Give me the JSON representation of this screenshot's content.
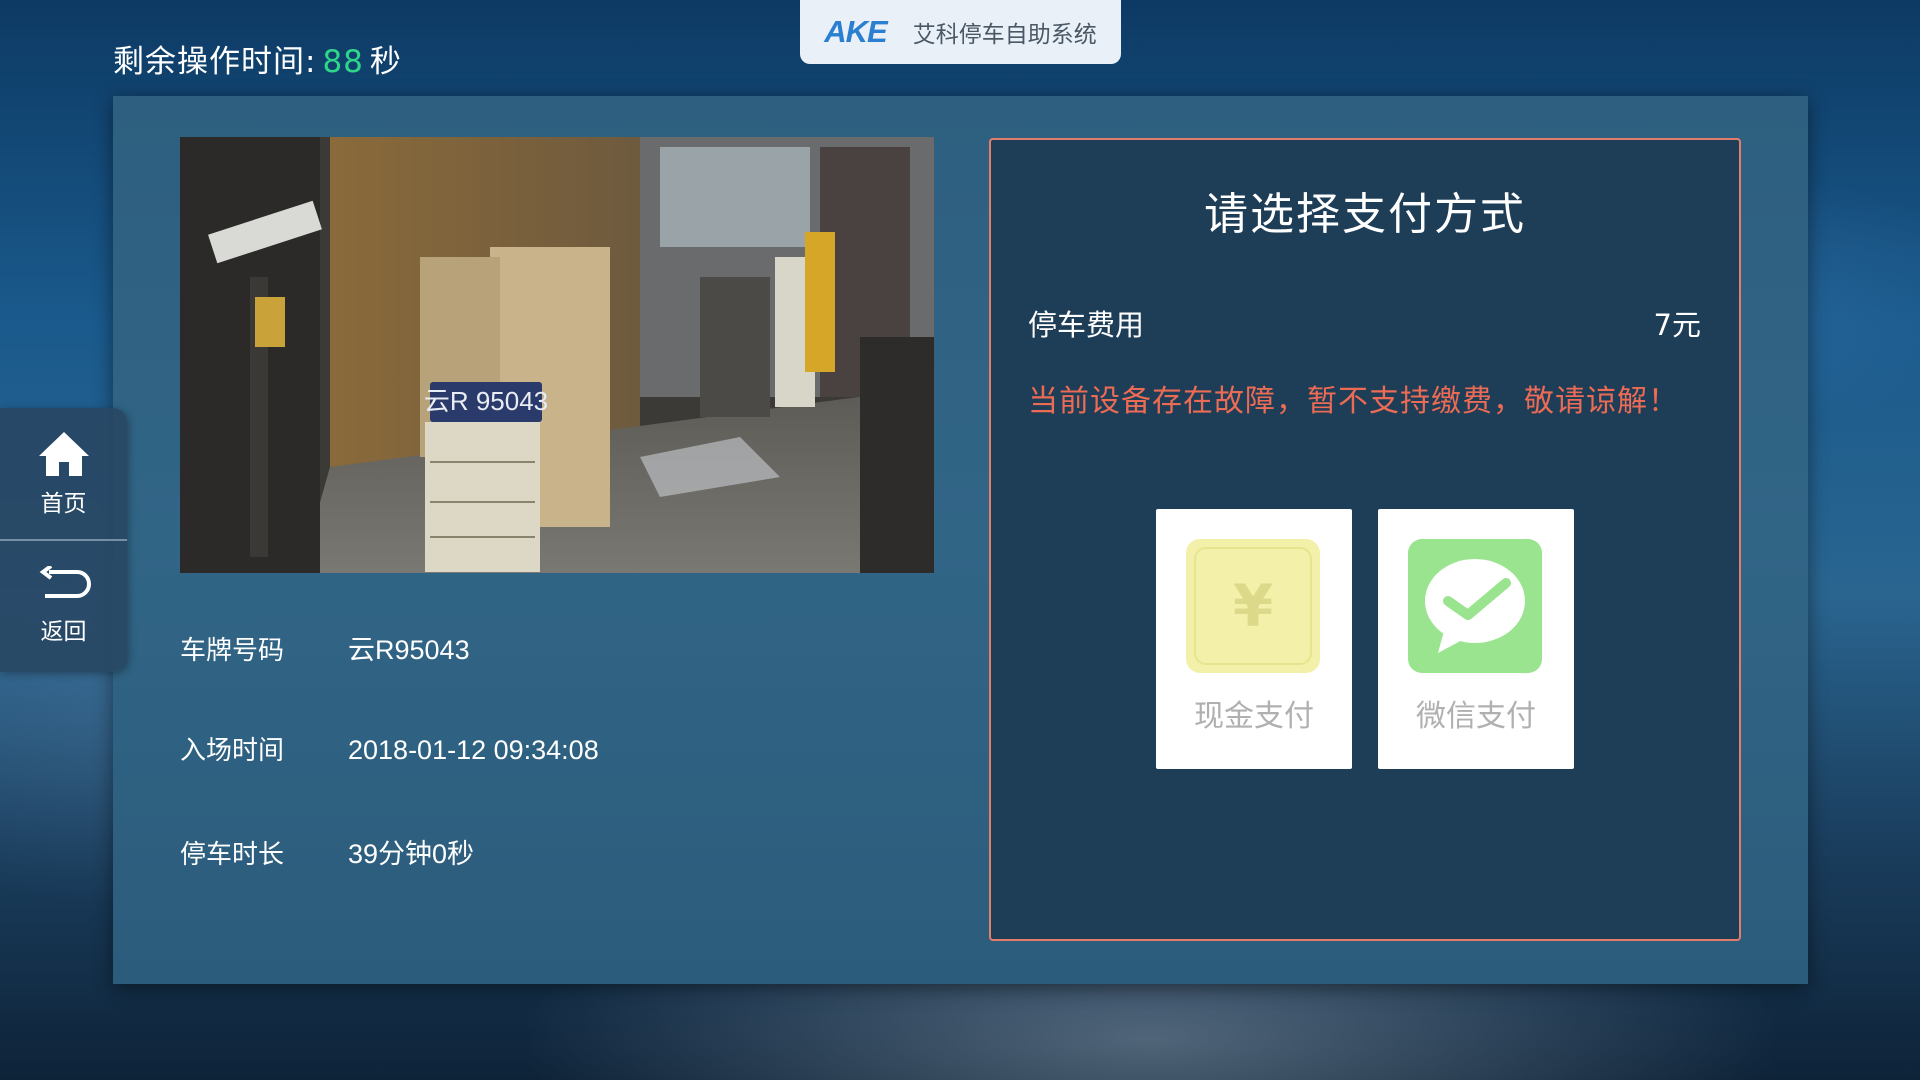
{
  "header": {
    "timer_label": "剩余操作时间:",
    "timer_value": "88",
    "timer_unit": "秒",
    "brand": "AKE",
    "system_name": "艾科停车自助系统"
  },
  "sidebar": {
    "items": [
      {
        "label": "首页",
        "icon": "home-icon"
      },
      {
        "label": "返回",
        "icon": "back-arrow-icon"
      }
    ]
  },
  "camera": {
    "plate_overlay": "云R 95043"
  },
  "vehicle": {
    "rows": [
      {
        "label": "车牌号码",
        "value": "云R95043"
      },
      {
        "label": "入场时间",
        "value": "2018-01-12 09:34:08"
      },
      {
        "label": "停车时长",
        "value": "39分钟0秒"
      }
    ]
  },
  "payment": {
    "title": "请选择支付方式",
    "fee_label": "停车费用",
    "fee_value": "7元",
    "fault_message": "当前设备存在故障，暂不支持缴费，敬请谅解！",
    "methods": [
      {
        "label": "现金支付",
        "icon": "cash-yen-icon",
        "symbol": "¥",
        "color": "#f3f1a9"
      },
      {
        "label": "微信支付",
        "icon": "wechat-icon",
        "color": "#9ae48f"
      }
    ]
  },
  "colors": {
    "timer_accent": "#2ed68a",
    "fault_text": "#ec6b55",
    "pay_box_border": "#e47e6c"
  }
}
